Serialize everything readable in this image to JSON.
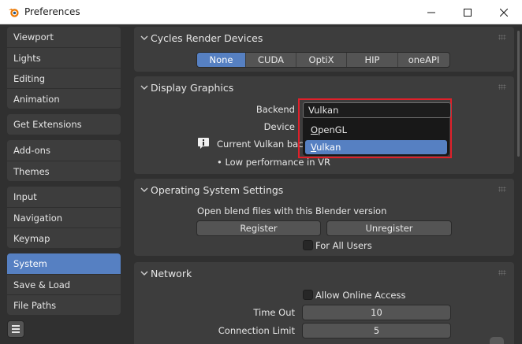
{
  "window": {
    "title": "Preferences"
  },
  "sidebar": {
    "groups": [
      {
        "items": [
          {
            "label": "Viewport"
          },
          {
            "label": "Lights"
          },
          {
            "label": "Editing"
          },
          {
            "label": "Animation"
          }
        ]
      },
      {
        "items": [
          {
            "label": "Get Extensions"
          }
        ]
      },
      {
        "items": [
          {
            "label": "Add-ons"
          },
          {
            "label": "Themes"
          }
        ]
      },
      {
        "items": [
          {
            "label": "Input"
          },
          {
            "label": "Navigation"
          },
          {
            "label": "Keymap"
          }
        ]
      },
      {
        "items": [
          {
            "label": "System",
            "active": true
          },
          {
            "label": "Save & Load"
          },
          {
            "label": "File Paths"
          }
        ]
      }
    ],
    "menu_icon": "hamburger-icon"
  },
  "cycles": {
    "title": "Cycles Render Devices",
    "devices": [
      {
        "label": "None",
        "active": true
      },
      {
        "label": "CUDA"
      },
      {
        "label": "OptiX"
      },
      {
        "label": "HIP"
      },
      {
        "label": "oneAPI"
      }
    ]
  },
  "display": {
    "title": "Display Graphics",
    "backend_label": "Backend",
    "backend_value": "Vulkan",
    "device_label": "Device",
    "options": [
      {
        "label": "OpenGL",
        "underline": "O"
      },
      {
        "label": "Vulkan",
        "underline": "V",
        "active": true
      }
    ],
    "info_text": "Current Vulkan backend",
    "bullet_text": "• Low performance in VR"
  },
  "os": {
    "title": "Operating System Settings",
    "open_label": "Open blend files with this Blender version",
    "register_label": "Register",
    "unregister_label": "Unregister",
    "all_users_label": "For All Users"
  },
  "network": {
    "title": "Network",
    "online_label": "Allow Online Access",
    "timeout_label": "Time Out",
    "timeout_value": "10",
    "conn_label": "Connection Limit",
    "conn_value": "5"
  },
  "colors": {
    "accent": "#5680c2",
    "highlight_border": "#e0202a",
    "panel": "#3d3d3d",
    "background": "#303030"
  }
}
